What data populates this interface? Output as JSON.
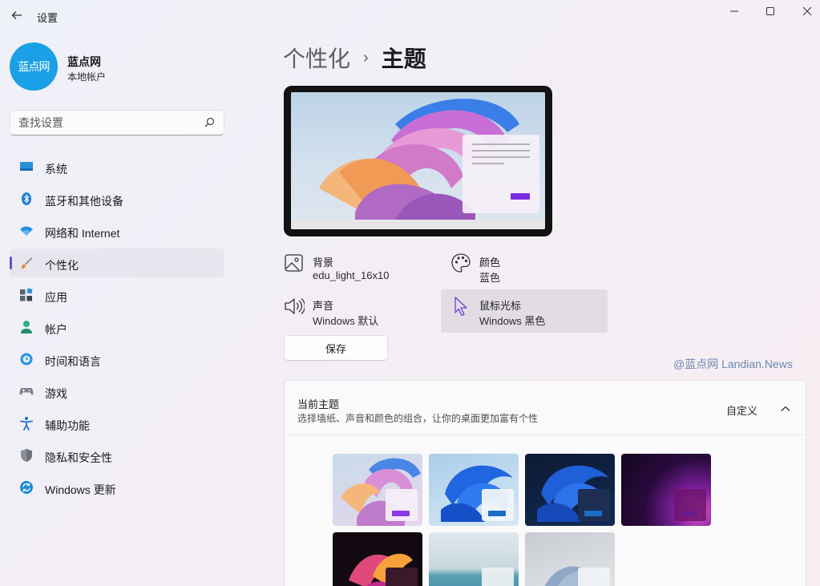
{
  "window": {
    "title": "设置"
  },
  "profile": {
    "avatar_text": "蓝点网",
    "name": "蓝点网",
    "account_type": "本地帐户"
  },
  "search": {
    "placeholder": "查找设置"
  },
  "sidebar": {
    "items": [
      {
        "label": "系统",
        "icon": "system-icon"
      },
      {
        "label": "蓝牙和其他设备",
        "icon": "bluetooth-icon"
      },
      {
        "label": "网络和 Internet",
        "icon": "wifi-icon"
      },
      {
        "label": "个性化",
        "icon": "brush-icon",
        "selected": true
      },
      {
        "label": "应用",
        "icon": "apps-icon"
      },
      {
        "label": "帐户",
        "icon": "account-icon"
      },
      {
        "label": "时间和语言",
        "icon": "time-language-icon"
      },
      {
        "label": "游戏",
        "icon": "gamepad-icon"
      },
      {
        "label": "辅助功能",
        "icon": "accessibility-icon"
      },
      {
        "label": "隐私和安全性",
        "icon": "shield-icon"
      },
      {
        "label": "Windows 更新",
        "icon": "update-icon"
      }
    ]
  },
  "breadcrumb": {
    "parent": "个性化",
    "separator": "›",
    "current": "主题"
  },
  "properties": {
    "background": {
      "title": "背景",
      "value": "edu_light_16x10",
      "icon": "image-icon"
    },
    "color": {
      "title": "颜色",
      "value": "蓝色",
      "icon": "palette-icon"
    },
    "sound": {
      "title": "声音",
      "value": "Windows 默认",
      "icon": "speaker-icon"
    },
    "cursor": {
      "title": "鼠标光标",
      "value": "Windows 黑色",
      "icon": "cursor-icon"
    }
  },
  "save_label": "保存",
  "watermark": "@蓝点网 Landian.News",
  "current_theme": {
    "title": "当前主题",
    "description": "选择墙纸、声音和颜色的组合，让你的桌面更加富有个性",
    "action_label": "自定义",
    "themes": [
      {
        "name": "windows-light-bloom"
      },
      {
        "name": "windows-blue-light"
      },
      {
        "name": "windows-blue-dark"
      },
      {
        "name": "glow"
      },
      {
        "name": "captured-motion"
      },
      {
        "name": "sunrise"
      },
      {
        "name": "flow"
      }
    ]
  },
  "colors": {
    "accent": "#6c4fd0",
    "avatar": "#1aa0e6",
    "highlight": "#e2dde5"
  }
}
